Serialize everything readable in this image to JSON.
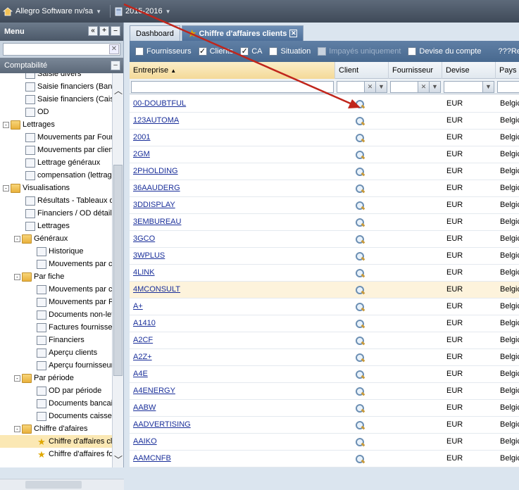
{
  "topbar": {
    "company": "Allegro Software nv/sa",
    "fiscal_year": "2015-2016"
  },
  "sidebar": {
    "menu_title": "Menu",
    "section": "Comptabilité",
    "items": [
      {
        "label": "Saisie divers",
        "indent": 2,
        "icon": "doc"
      },
      {
        "label": "Saisie financiers (Ban",
        "indent": 2,
        "icon": "doc"
      },
      {
        "label": "Saisie financiers (Caiss",
        "indent": 2,
        "icon": "doc"
      },
      {
        "label": "OD",
        "indent": 2,
        "icon": "doc"
      },
      {
        "label": "Lettrages",
        "indent": 0,
        "icon": "folder",
        "expander": "-"
      },
      {
        "label": "Mouvements par Four",
        "indent": 2,
        "icon": "doc"
      },
      {
        "label": "Mouvements par client",
        "indent": 2,
        "icon": "doc"
      },
      {
        "label": "Lettrage généraux",
        "indent": 2,
        "icon": "doc"
      },
      {
        "label": "compensation (lettrag",
        "indent": 2,
        "icon": "doc"
      },
      {
        "label": "Visualisations",
        "indent": 0,
        "icon": "folder",
        "expander": "-"
      },
      {
        "label": "Résultats - Tableaux d",
        "indent": 2,
        "icon": "doc"
      },
      {
        "label": "Financiers / OD détail",
        "indent": 2,
        "icon": "doc"
      },
      {
        "label": "Lettrages",
        "indent": 2,
        "icon": "doc"
      },
      {
        "label": "Généraux",
        "indent": 1,
        "icon": "folder",
        "expander": "-"
      },
      {
        "label": "Historique",
        "indent": 3,
        "icon": "doc"
      },
      {
        "label": "Mouvements par c",
        "indent": 3,
        "icon": "doc"
      },
      {
        "label": "Par fiche",
        "indent": 1,
        "icon": "folder",
        "expander": "-"
      },
      {
        "label": "Mouvements par c",
        "indent": 3,
        "icon": "doc"
      },
      {
        "label": "Mouvements par F",
        "indent": 3,
        "icon": "doc"
      },
      {
        "label": "Documents non-let",
        "indent": 3,
        "icon": "doc"
      },
      {
        "label": "Factures fournisse",
        "indent": 3,
        "icon": "doc"
      },
      {
        "label": "Financiers",
        "indent": 3,
        "icon": "doc"
      },
      {
        "label": "Aperçu clients",
        "indent": 3,
        "icon": "doc"
      },
      {
        "label": "Aperçu fournisseur",
        "indent": 3,
        "icon": "doc"
      },
      {
        "label": "Par période",
        "indent": 1,
        "icon": "folder",
        "expander": "-"
      },
      {
        "label": "OD par période",
        "indent": 3,
        "icon": "doc"
      },
      {
        "label": "Documents bancai",
        "indent": 3,
        "icon": "doc"
      },
      {
        "label": "Documents caisse",
        "indent": 3,
        "icon": "doc"
      },
      {
        "label": "Chiffre d'afaires",
        "indent": 1,
        "icon": "folder",
        "expander": "-"
      },
      {
        "label": "Chiffre d'affaires cl",
        "indent": 3,
        "icon": "star",
        "selected": true
      },
      {
        "label": "Chiffre d'affaires fo",
        "indent": 3,
        "icon": "star"
      }
    ]
  },
  "tabs": [
    {
      "label": "Dashboard",
      "active": false
    },
    {
      "label": "Chiffre d'affaires clients",
      "active": true
    }
  ],
  "filters": [
    {
      "label": "Fournisseurs",
      "checked": false,
      "disabled": false
    },
    {
      "label": "Clients",
      "checked": true,
      "disabled": false
    },
    {
      "label": "CA",
      "checked": true,
      "disabled": false
    },
    {
      "label": "Situation",
      "checked": false,
      "disabled": false
    },
    {
      "label": "Impayés uniquement",
      "checked": false,
      "disabled": true
    },
    {
      "label": "Devise du compte",
      "checked": false,
      "disabled": false
    }
  ],
  "filters_extra": "???Re",
  "grid": {
    "columns": [
      "Entreprise",
      "Client",
      "Fournisseur",
      "Devise",
      "Pays"
    ],
    "rows": [
      {
        "name": "00-DOUBTFUL",
        "devise": "EUR",
        "pays": "Belgic"
      },
      {
        "name": "123AUTOMA",
        "devise": "EUR",
        "pays": "Belgic"
      },
      {
        "name": "2001",
        "devise": "EUR",
        "pays": "Belgic"
      },
      {
        "name": "2GM",
        "devise": "EUR",
        "pays": "Belgic"
      },
      {
        "name": "2PHOLDING",
        "devise": "EUR",
        "pays": "Belgic"
      },
      {
        "name": "36AAUDERG",
        "devise": "EUR",
        "pays": "Belgic"
      },
      {
        "name": "3DDISPLAY",
        "devise": "EUR",
        "pays": "Belgic"
      },
      {
        "name": "3EMBUREAU",
        "devise": "EUR",
        "pays": "Belgic"
      },
      {
        "name": "3GCO",
        "devise": "EUR",
        "pays": "Belgic"
      },
      {
        "name": "3WPLUS",
        "devise": "EUR",
        "pays": "Belgic"
      },
      {
        "name": "4LINK",
        "devise": "EUR",
        "pays": "Belgic"
      },
      {
        "name": "4MCONSULT",
        "devise": "EUR",
        "pays": "Belgic",
        "highlight": true
      },
      {
        "name": "A+",
        "devise": "EUR",
        "pays": "Belgic"
      },
      {
        "name": "A1410",
        "devise": "EUR",
        "pays": "Belgic"
      },
      {
        "name": "A2CF",
        "devise": "EUR",
        "pays": "Belgic"
      },
      {
        "name": "A2Z+",
        "devise": "EUR",
        "pays": "Belgic"
      },
      {
        "name": "A4E",
        "devise": "EUR",
        "pays": "Belgic"
      },
      {
        "name": "A4ENERGY",
        "devise": "EUR",
        "pays": "Belgic"
      },
      {
        "name": "AABW",
        "devise": "EUR",
        "pays": "Belgic"
      },
      {
        "name": "AADVERTISING",
        "devise": "EUR",
        "pays": "Belgic"
      },
      {
        "name": "AAIKO",
        "devise": "EUR",
        "pays": "Belgic"
      },
      {
        "name": "AAMCNFB",
        "devise": "EUR",
        "pays": "Belgic"
      }
    ]
  },
  "colors": {
    "arrow": "#c0251b",
    "link": "#1a2f9a",
    "highlight": "#fdf3dc"
  }
}
